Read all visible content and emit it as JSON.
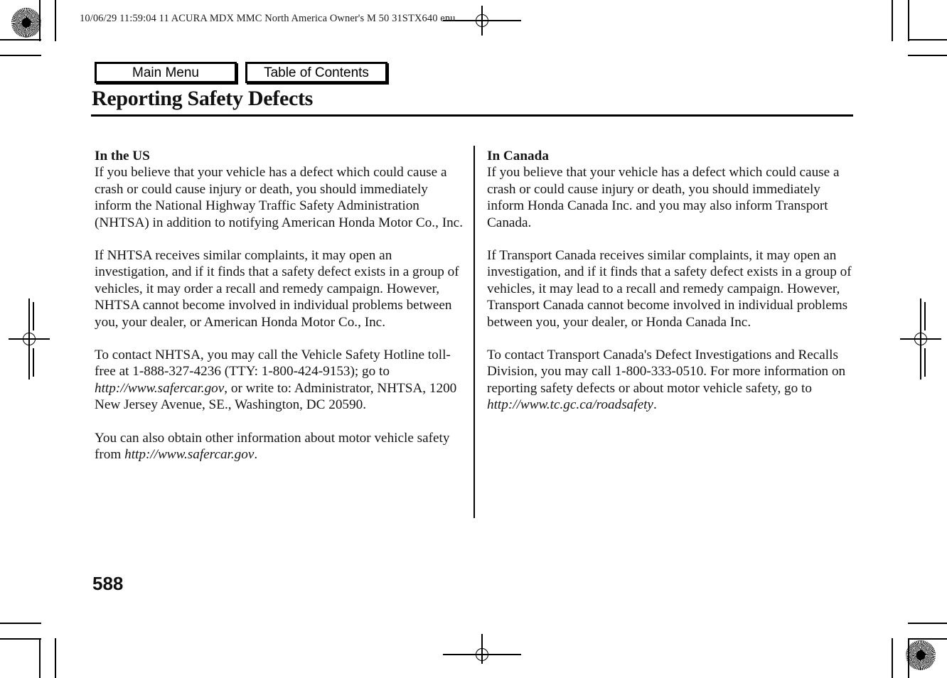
{
  "scan_header": {
    "text": "10/06/29 11:59:04   11 ACURA MDX MMC North America Owner's M 50 31STX640 enu"
  },
  "nav": {
    "main_menu_label": "Main Menu",
    "toc_label": "Table of Contents"
  },
  "page": {
    "title": "Reporting Safety Defects",
    "number": "588"
  },
  "columns": {
    "left": {
      "heading": "In the US",
      "paragraph_1": "If you believe that your vehicle has a defect which could cause a crash or could cause injury or death, you should immediately inform the National Highway Traffic Safety Administration (NHTSA) in addition to notifying American Honda Motor Co., Inc.",
      "paragraph_2": "If NHTSA receives similar complaints, it may open an investigation, and if it finds that a safety defect exists in a group of vehicles, it may order a recall and remedy campaign. However, NHTSA cannot become involved in individual problems between you, your dealer, or American Honda Motor Co., Inc.",
      "paragraph_3_part_1": "To contact NHTSA, you may call the Vehicle Safety Hotline toll-free at 1-888-327-4236 (TTY: 1-800-424-9153); go to ",
      "paragraph_3_url": "http://www.safercar.gov",
      "paragraph_3_part_2": ", or write to: Administrator, NHTSA, 1200 New Jersey Avenue, SE., Washington, DC 20590.",
      "paragraph_4_part_1": "You can also obtain other information about motor vehicle safety from ",
      "paragraph_4_url": "http://www.safercar.gov",
      "paragraph_4_part_2": "."
    },
    "right": {
      "heading": "In Canada",
      "paragraph_1": "If you believe that your vehicle has a defect which could cause a crash or could cause injury or death, you should immediately inform Honda Canada Inc. and you may also inform Transport Canada.",
      "paragraph_2": "If Transport Canada receives similar complaints, it may open an investigation, and if it finds that a safety defect exists in a group of vehicles, it may lead to a recall and remedy campaign. However, Transport Canada cannot become involved in individual problems between you, your dealer, or Honda Canada Inc.",
      "paragraph_3_part_1": "To contact Transport Canada's Defect Investigations and Recalls Division, you may call 1-800-333-0510. For more information on reporting safety defects or about motor vehicle safety, go to ",
      "paragraph_3_url": "http://www.tc.gc.ca/roadsafety",
      "paragraph_3_part_2": "."
    }
  }
}
